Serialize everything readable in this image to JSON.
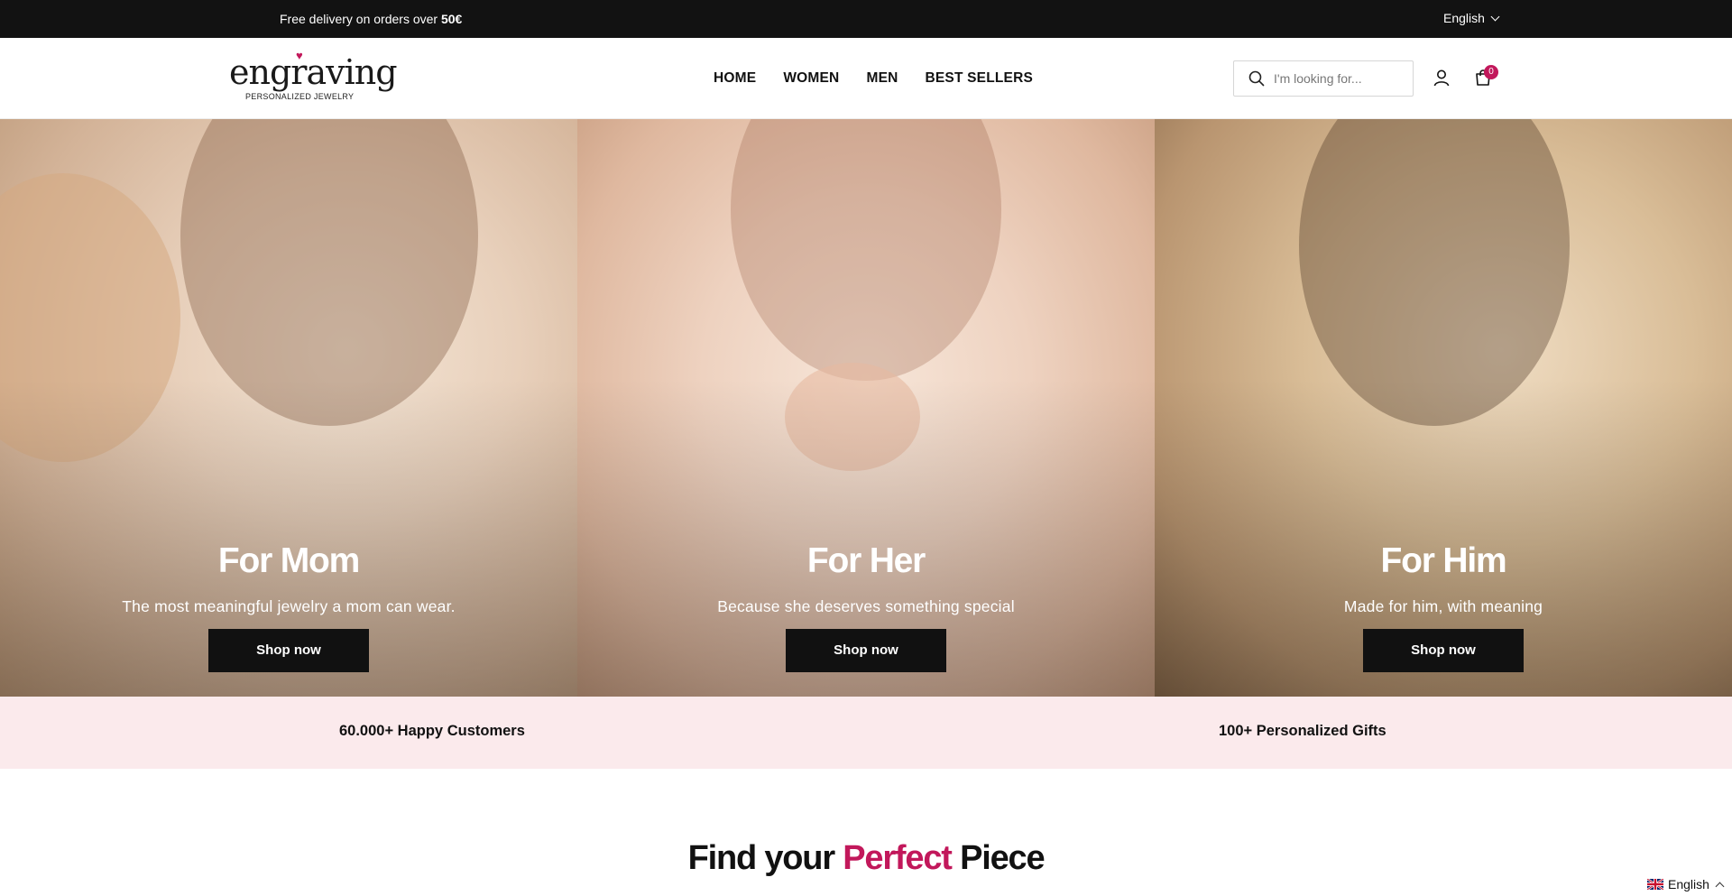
{
  "announcement": {
    "text_prefix": "Free delivery on orders over",
    "text_amount": "50€",
    "language": "English"
  },
  "header": {
    "logo": {
      "word": "engraving",
      "tagline": "PERSONALIZED JEWELRY"
    },
    "nav": [
      "HOME",
      "WOMEN",
      "MEN",
      "BEST SELLERS"
    ],
    "search": {
      "placeholder": "I'm looking for...",
      "value": ""
    },
    "cart_count": "0"
  },
  "hero": [
    {
      "title": "For Mom",
      "subtitle": "The most meaningful jewelry a mom can wear.",
      "button": "Shop now"
    },
    {
      "title": "For Her",
      "subtitle": "Because she deserves something special",
      "button": "Shop now"
    },
    {
      "title": "For Him",
      "subtitle": "Made for him, with meaning",
      "button": "Shop now"
    }
  ],
  "stats": [
    "60.000+ Happy Customers",
    "100+ Personalized Gifts"
  ],
  "section": {
    "title_before": "Find your",
    "title_accent": "Perfect",
    "title_after": "Piece"
  },
  "language_widget": {
    "label": "English"
  },
  "colors": {
    "accent": "#c2185b",
    "topbar": "#121212",
    "stats_bg": "#fbeaec"
  }
}
